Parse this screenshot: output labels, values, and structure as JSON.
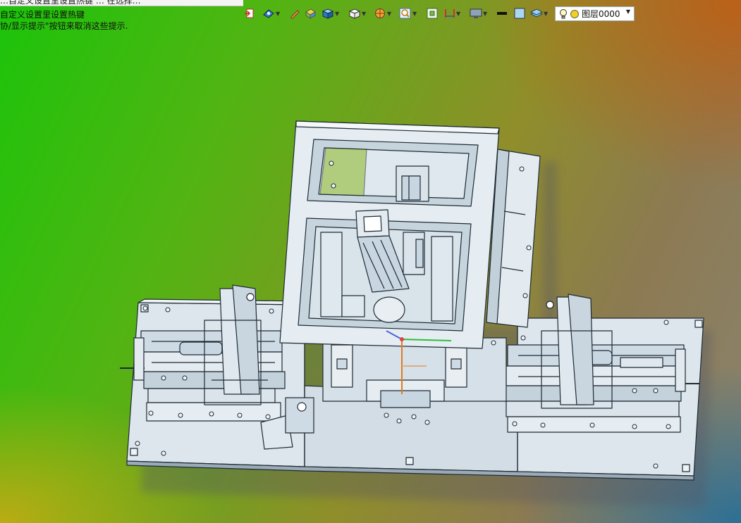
{
  "hints": {
    "top_fragment": "…自定义设置里设置热键 … 在选择…",
    "line1": "自定义设置里设置热键",
    "line2": "协/显示提示\"按钮来取消这些提示."
  },
  "toolbar": {
    "items": [
      {
        "name": "exit-icon",
        "dropdown": false
      },
      {
        "name": "view-orient-icon",
        "dropdown": true
      },
      {
        "name": "pen-icon",
        "dropdown": false
      },
      {
        "name": "shaded-solid-icon",
        "dropdown": false
      },
      {
        "name": "box-render-icon",
        "dropdown": true
      },
      {
        "name": "wireframe-box-icon",
        "dropdown": true
      },
      {
        "name": "sphere-section-icon",
        "dropdown": true
      },
      {
        "name": "zoom-icon",
        "dropdown": true
      },
      {
        "name": "fit-view-icon",
        "dropdown": false
      },
      {
        "name": "ruler-icon",
        "dropdown": true
      },
      {
        "name": "display-monitor-icon",
        "dropdown": true
      },
      {
        "name": "line-color-swatch-icon",
        "dropdown": false
      },
      {
        "name": "fill-color-swatch-icon",
        "dropdown": false
      },
      {
        "name": "layer-stack-icon",
        "dropdown": true
      }
    ]
  },
  "layer": {
    "name": "图层0000",
    "visible_icon": "bulb-icon",
    "state_icon": "sun-icon"
  },
  "colors": {
    "part_fill": "#d9e3ea",
    "part_fill_dark": "#b7c7d3",
    "outline": "#1e2a34",
    "motor_fill": "#c8d6e2"
  }
}
